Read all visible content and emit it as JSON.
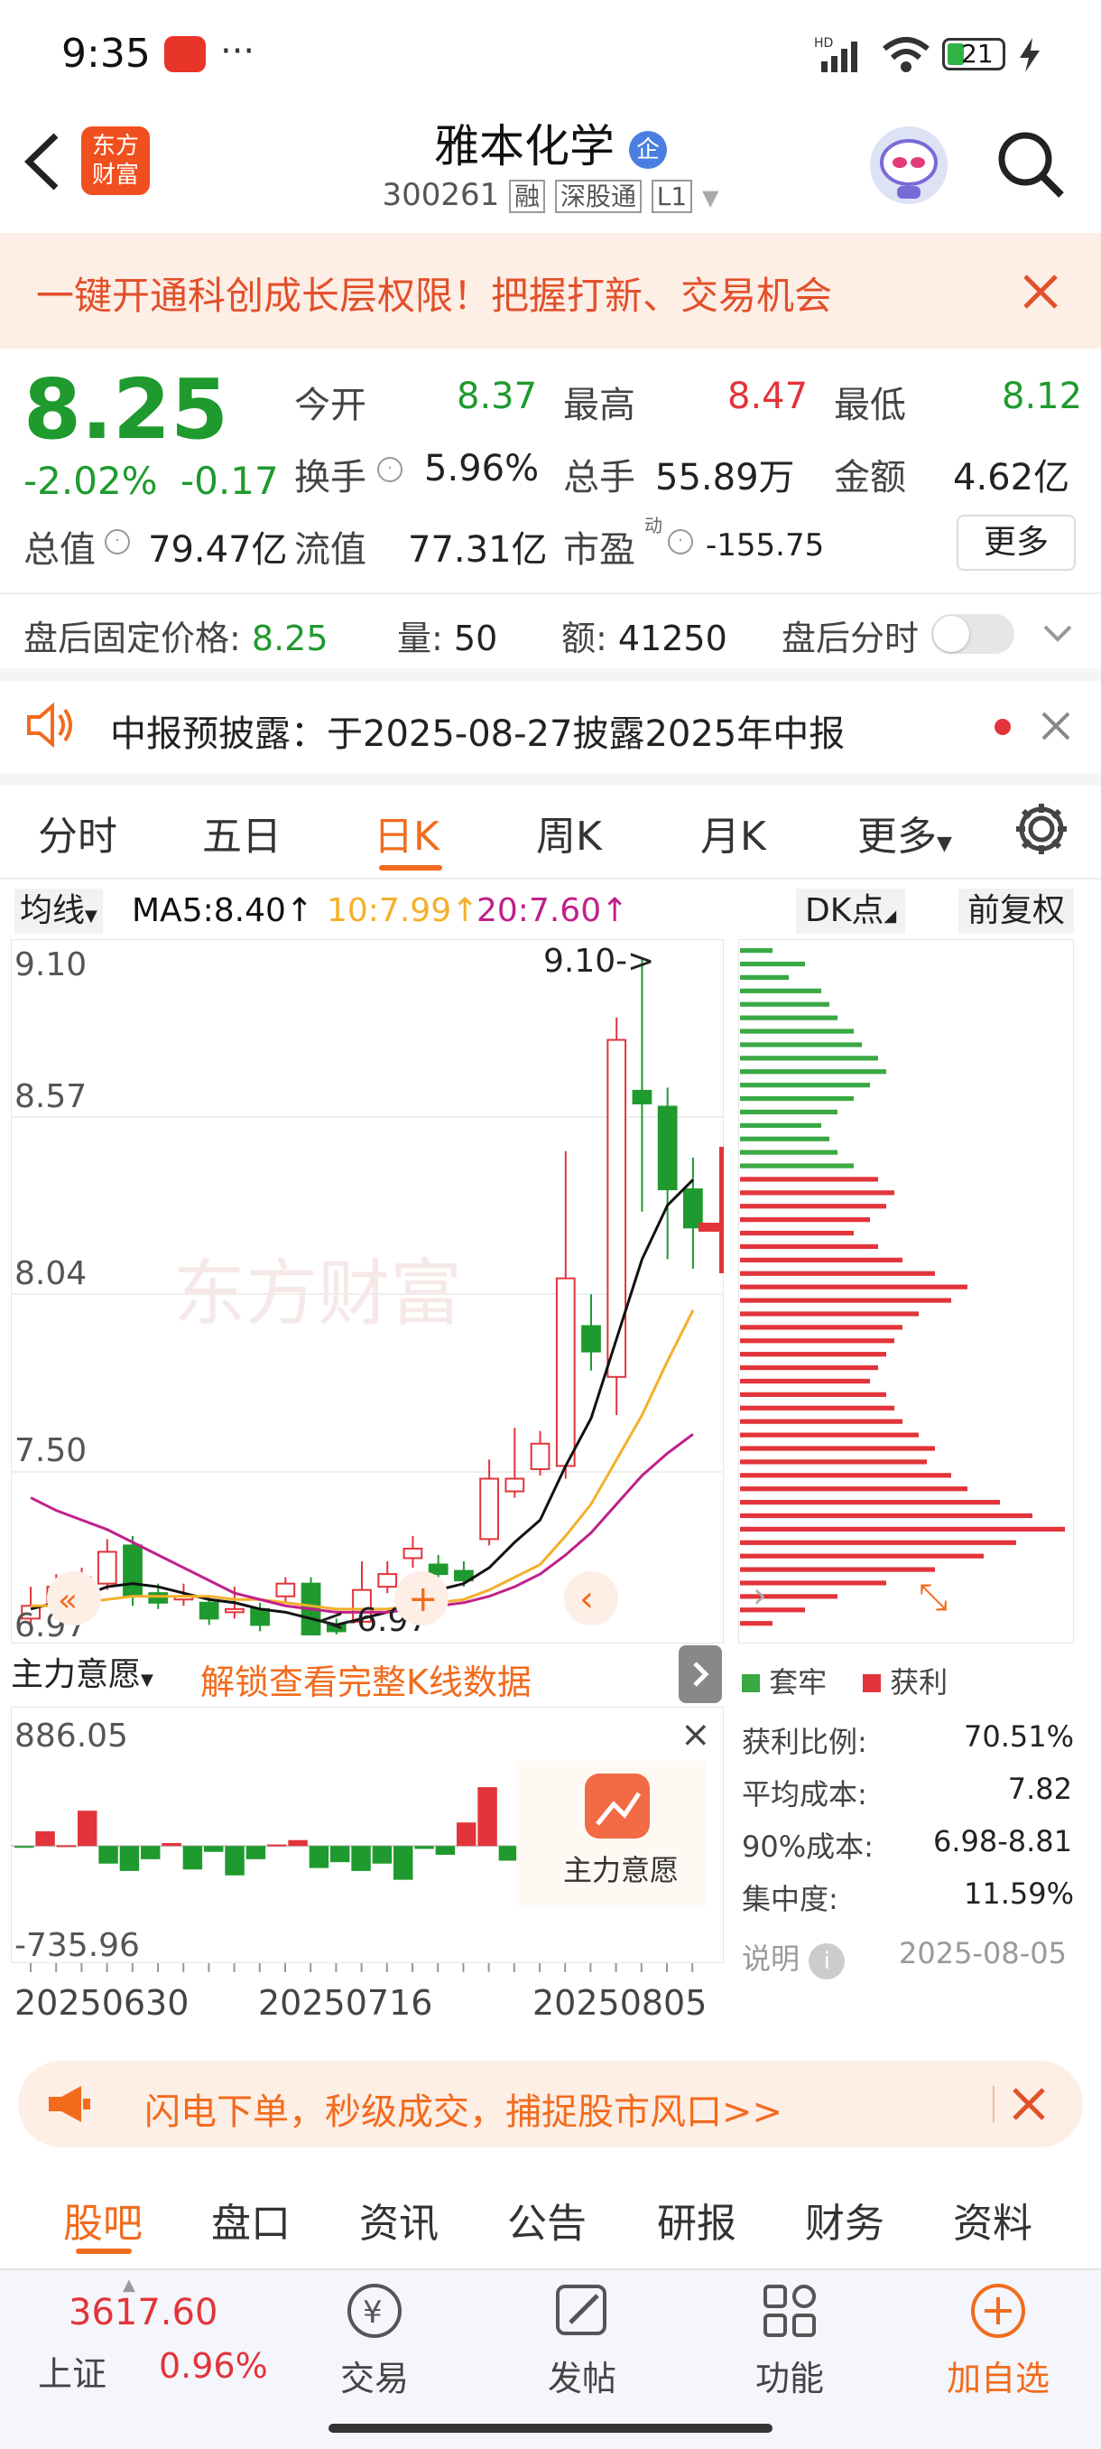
{
  "status": {
    "time": "9:35",
    "dots": "···",
    "battery": "21"
  },
  "header": {
    "logo_line1": "东方",
    "logo_line2": "财富",
    "title": "雅本化学",
    "title_badge": "企",
    "code": "300261",
    "tags": [
      "融",
      "深股通",
      "L1"
    ]
  },
  "banner": {
    "text": "一键开通科创成长层权限！把握打新、交易机会"
  },
  "quote": {
    "price": "8.25",
    "change_pct": "-2.02%",
    "change": "-0.17",
    "open_label": "今开",
    "open": "8.37",
    "high_label": "最高",
    "high": "8.47",
    "low_label": "最低",
    "low": "8.12",
    "turnover_label": "换手",
    "turnover": "5.96%",
    "volume_label": "总手",
    "volume": "55.89万",
    "amount_label": "金额",
    "amount": "4.62亿",
    "mktcap_label": "总值",
    "mktcap": "79.47亿",
    "float_label": "流值",
    "float": "77.31亿",
    "pe_label": "市盈",
    "pe_sup": "动",
    "pe": "-155.75",
    "more_label": "更多"
  },
  "after_hours": {
    "price_label": "盘后固定价格:",
    "price": "8.25",
    "vol_label": "量:",
    "vol": "50",
    "amt_label": "额:",
    "amt": "41250",
    "toggle_label": "盘后分时"
  },
  "notice": {
    "text": "中报预披露：于2025-08-27披露2025年中报"
  },
  "chart_tabs": [
    "分时",
    "五日",
    "日K",
    "周K",
    "月K",
    "更多"
  ],
  "active_chart_tab": "日K",
  "ma_bar": {
    "selector": "均线",
    "ma5": "MA5:8.40↑",
    "ma10": "10:7.99↑",
    "ma20": "20:7.60↑",
    "dk": "DK点",
    "adjust": "前复权"
  },
  "colors": {
    "up": "#e2343a",
    "down": "#1f9a2e",
    "ma5": "#111111",
    "ma10": "#f4b02a",
    "ma20": "#c0208a",
    "accent": "#f26b1d"
  },
  "kchart_labels": {
    "y_top": "9.10",
    "y2": "8.57",
    "y3": "8.04",
    "y4": "7.50",
    "y_bottom": "6.97",
    "max_note": "9.10->",
    "min_note": "<-6.97"
  },
  "chart_data": [
    {
      "type": "candlestick",
      "title": "",
      "ylim": [
        6.97,
        9.1
      ],
      "ticks": [
        "9.10",
        "8.57",
        "8.04",
        "7.50",
        "6.97"
      ],
      "candles": [
        {
          "o": 7.02,
          "c": 7.06,
          "h": 7.12,
          "l": 6.99
        },
        {
          "o": 7.06,
          "c": 7.12,
          "h": 7.16,
          "l": 7.02
        },
        {
          "o": 7.11,
          "c": 7.15,
          "h": 7.18,
          "l": 7.08
        },
        {
          "o": 7.13,
          "c": 7.23,
          "h": 7.27,
          "l": 7.11
        },
        {
          "o": 7.25,
          "c": 7.09,
          "h": 7.28,
          "l": 7.06
        },
        {
          "o": 7.1,
          "c": 7.07,
          "h": 7.13,
          "l": 7.05
        },
        {
          "o": 7.08,
          "c": 7.09,
          "h": 7.13,
          "l": 7.06
        },
        {
          "o": 7.07,
          "c": 7.02,
          "h": 7.09,
          "l": 7.0
        },
        {
          "o": 7.04,
          "c": 7.05,
          "h": 7.12,
          "l": 7.02
        },
        {
          "o": 7.05,
          "c": 7.0,
          "h": 7.07,
          "l": 6.98
        },
        {
          "o": 7.09,
          "c": 7.13,
          "h": 7.15,
          "l": 7.07
        },
        {
          "o": 7.13,
          "c": 6.97,
          "h": 7.15,
          "l": 6.97
        },
        {
          "o": 7.0,
          "c": 6.98,
          "h": 7.02,
          "l": 6.97
        },
        {
          "o": 7.01,
          "c": 7.11,
          "h": 7.2,
          "l": 7.0
        },
        {
          "o": 7.12,
          "c": 7.16,
          "h": 7.2,
          "l": 7.1
        },
        {
          "o": 7.21,
          "c": 7.24,
          "h": 7.28,
          "l": 7.18
        },
        {
          "o": 7.19,
          "c": 7.16,
          "h": 7.22,
          "l": 7.15
        },
        {
          "o": 7.17,
          "c": 7.14,
          "h": 7.2,
          "l": 7.12
        },
        {
          "o": 7.27,
          "c": 7.46,
          "h": 7.52,
          "l": 7.25
        },
        {
          "o": 7.42,
          "c": 7.46,
          "h": 7.62,
          "l": 7.4
        },
        {
          "o": 7.49,
          "c": 7.57,
          "h": 7.61,
          "l": 7.47
        },
        {
          "o": 7.5,
          "c": 8.09,
          "h": 8.49,
          "l": 7.46
        },
        {
          "o": 7.94,
          "c": 7.86,
          "h": 8.04,
          "l": 7.8
        },
        {
          "o": 7.78,
          "c": 8.84,
          "h": 8.91,
          "l": 7.66
        },
        {
          "o": 8.68,
          "c": 8.64,
          "h": 9.1,
          "l": 8.3
        },
        {
          "o": 8.63,
          "c": 8.37,
          "h": 8.69,
          "l": 8.15
        },
        {
          "o": 8.37,
          "c": 8.25,
          "h": 8.47,
          "l": 8.12
        }
      ],
      "series": [
        {
          "name": "MA5",
          "values": [
            7.05,
            7.07,
            7.09,
            7.12,
            7.13,
            7.12,
            7.1,
            7.08,
            7.07,
            7.05,
            7.04,
            7.02,
            7.0,
            7.02,
            7.04,
            7.08,
            7.11,
            7.13,
            7.18,
            7.26,
            7.33,
            7.5,
            7.65,
            7.9,
            8.15,
            8.32,
            8.4
          ]
        },
        {
          "name": "MA10",
          "values": [
            7.06,
            7.06,
            7.07,
            7.08,
            7.09,
            7.09,
            7.09,
            7.09,
            7.08,
            7.08,
            7.07,
            7.06,
            7.05,
            7.05,
            7.05,
            7.06,
            7.07,
            7.08,
            7.11,
            7.15,
            7.19,
            7.28,
            7.38,
            7.52,
            7.66,
            7.83,
            7.99
          ]
        },
        {
          "name": "MA20",
          "values": [
            7.4,
            7.36,
            7.33,
            7.3,
            7.26,
            7.22,
            7.18,
            7.14,
            7.1,
            7.08,
            7.06,
            7.05,
            7.04,
            7.04,
            7.04,
            7.05,
            7.06,
            7.07,
            7.09,
            7.12,
            7.16,
            7.22,
            7.29,
            7.38,
            7.47,
            7.54,
            7.6
          ]
        }
      ]
    },
    {
      "type": "bar",
      "title": "主力意愿",
      "ylim": [
        -735.96,
        886.05
      ],
      "values": [
        -10,
        100,
        5,
        240,
        -120,
        -170,
        -90,
        20,
        -160,
        -40,
        -200,
        -90,
        10,
        40,
        -150,
        -110,
        -170,
        -120,
        -230,
        -20,
        -60,
        160,
        400,
        -100
      ]
    },
    {
      "type": "bar",
      "title": "筹码分布",
      "values": [
        20,
        40,
        30,
        50,
        55,
        60,
        70,
        75,
        85,
        90,
        80,
        70,
        60,
        50,
        55,
        60,
        70,
        85,
        95,
        90,
        80,
        70,
        85,
        100,
        120,
        140,
        130,
        110,
        100,
        95,
        90,
        85,
        80,
        90,
        95,
        100,
        110,
        120,
        115,
        130,
        140,
        160,
        180,
        200,
        170,
        150,
        120,
        90,
        60,
        40,
        20
      ]
    }
  ],
  "vol_labels": {
    "selector": "主力意愿",
    "unlock": "解锁查看完整K线数据",
    "y_top": "886.05",
    "y_bottom": "-735.96",
    "badge_label": "主力意愿"
  },
  "x_dates": [
    "20250630",
    "20250716",
    "20250805"
  ],
  "chip": {
    "legend_trapped": "套牢",
    "legend_profit": "获利",
    "profit_ratio_label": "获利比例:",
    "profit_ratio": "70.51%",
    "avg_cost_label": "平均成本:",
    "avg_cost": "7.82",
    "cost90_label": "90%成本:",
    "cost90": "6.98-8.81",
    "concentration_label": "集中度:",
    "concentration": "11.59%",
    "note_label": "说明",
    "date": "2025-08-05"
  },
  "promo": {
    "text": "闪电下单，秒级成交，捕捉股市风口>>"
  },
  "bottom_tabs": [
    "股吧",
    "盘口",
    "资讯",
    "公告",
    "研报",
    "财务",
    "资料"
  ],
  "active_bottom_tab": "股吧",
  "nav": {
    "index_value": "3617.60",
    "index_name": "上证",
    "index_change": "0.96%",
    "trade": "交易",
    "post": "发帖",
    "func": "功能",
    "add": "加自选"
  }
}
